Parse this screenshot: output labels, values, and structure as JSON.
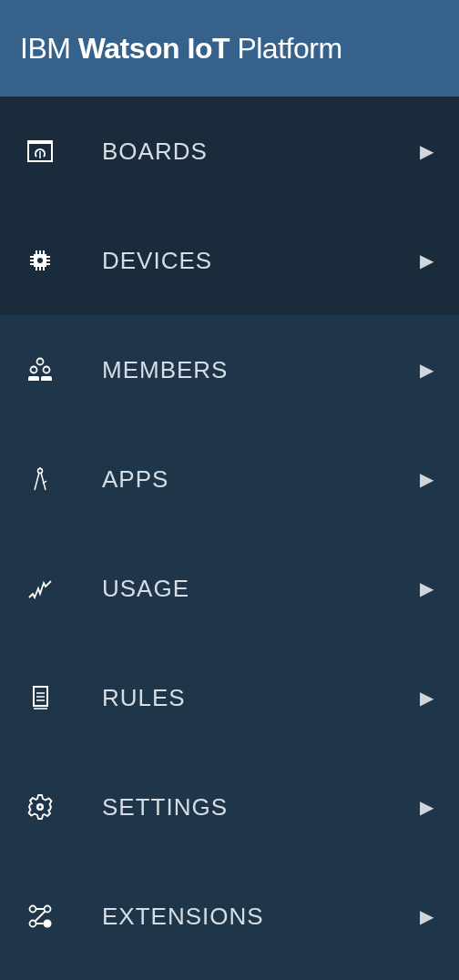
{
  "header": {
    "title": "IBM **Watson IoT** Platform"
  },
  "menu": [
    {
      "label": "BOARDS",
      "arrow": "▶",
      "highlighted": true
    },
    {
      "label": "DEVICES",
      "arrow": "▶",
      "highlighted": true
    },
    {
      "label": "MEMBERS",
      "arrow": "▶",
      "highlighted": false
    },
    {
      "label": "APPS",
      "arrow": "▶",
      "highlighted": false
    },
    {
      "label": "USAGE",
      "arrow": "▶",
      "highlighted": false
    },
    {
      "label": "RULES",
      "arrow": "▶",
      "highlighted": false
    },
    {
      "label": "SETTINGS",
      "arrow": "▶",
      "highlighted": false
    },
    {
      "label": "EXTENSIONS",
      "arrow": "▶",
      "highlighted": false
    }
  ]
}
